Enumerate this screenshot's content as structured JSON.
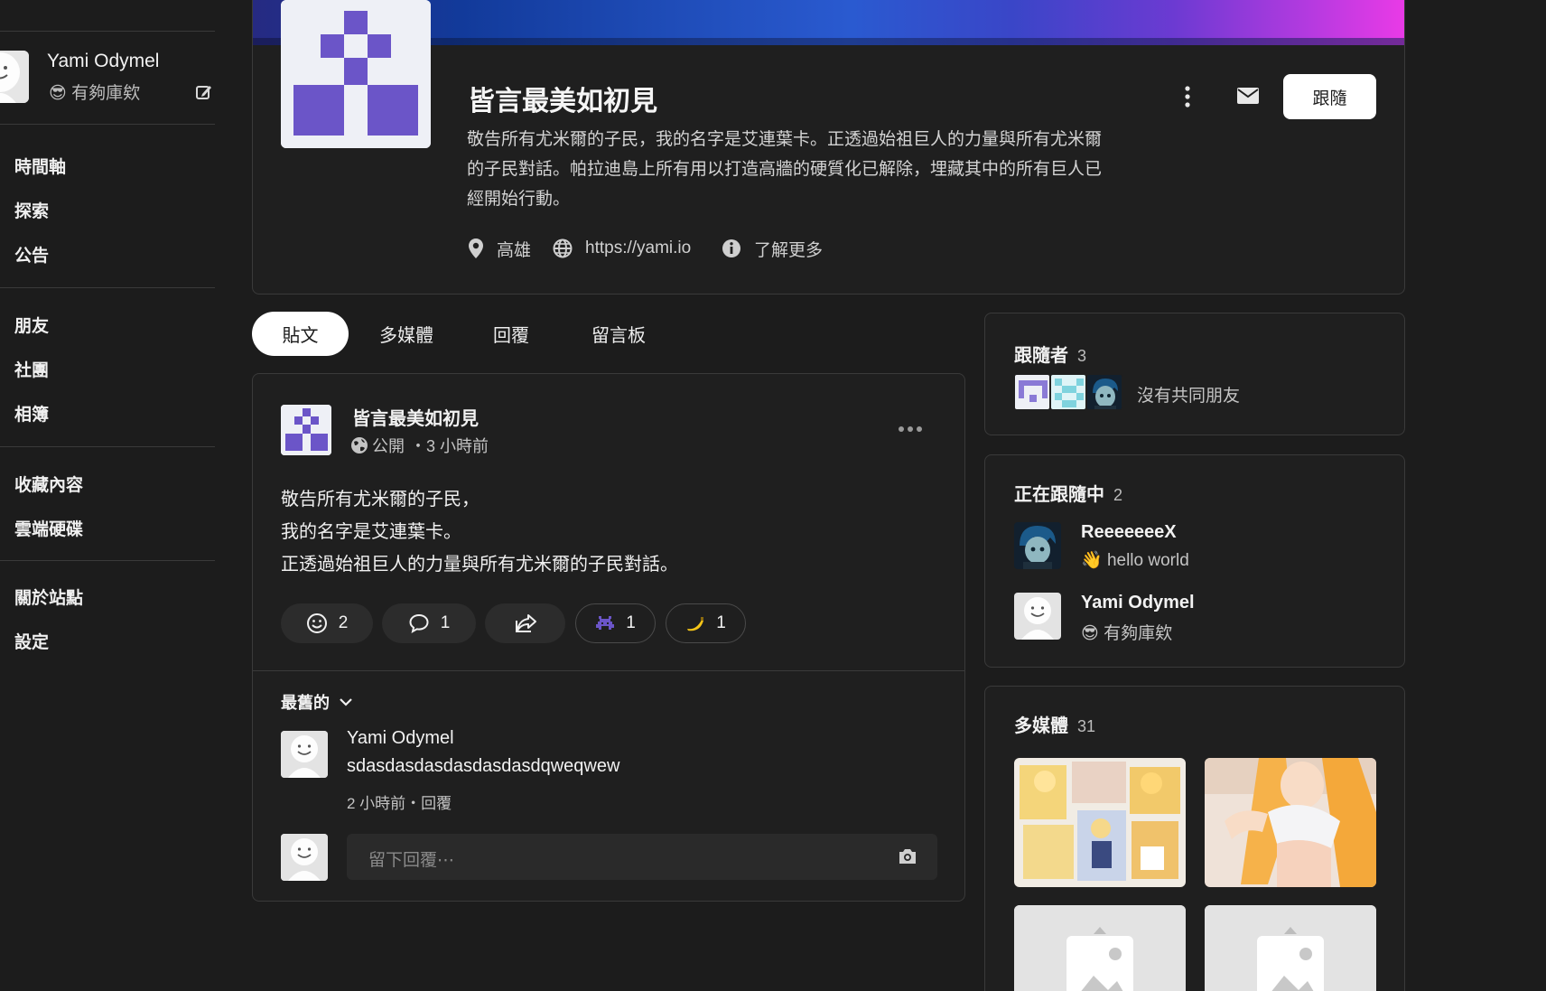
{
  "sidebar": {
    "user": {
      "name": "Yami Odymel",
      "status_emoji": "😎",
      "status": "有夠庫欸"
    },
    "nav": [
      {
        "label": "時間軸"
      },
      {
        "label": "探索"
      },
      {
        "label": "公告"
      },
      {
        "label": "朋友"
      },
      {
        "label": "社團"
      },
      {
        "label": "相簿"
      },
      {
        "label": "收藏內容"
      },
      {
        "label": "雲端硬碟"
      },
      {
        "label": "關於站點"
      },
      {
        "label": "設定"
      }
    ]
  },
  "profile": {
    "name": "皆言最美如初見",
    "bio": "敬告所有尤米爾的子民，我的名字是艾連葉卡。正透過始祖巨人的力量與所有尤米爾的子民對話。帕拉迪島上所有用以打造高牆的硬質化已解除，埋藏其中的所有巨人已經開始行動。",
    "location": "高雄",
    "website": "https://yami.io",
    "more": "了解更多",
    "follow_label": "跟隨"
  },
  "tabs": [
    {
      "label": "貼文",
      "active": true
    },
    {
      "label": "多媒體",
      "active": false
    },
    {
      "label": "回覆",
      "active": false
    },
    {
      "label": "留言板",
      "active": false
    }
  ],
  "post": {
    "author": "皆言最美如初見",
    "visibility": "公開",
    "time": "・3 小時前",
    "lines": [
      "敬告所有尤米爾的子民，",
      "我的名字是艾連葉卡。",
      "正透過始祖巨人的力量與所有尤米爾的子民對話。"
    ],
    "reactions": [
      {
        "icon": "smile-icon",
        "count": "2"
      },
      {
        "icon": "comment-icon",
        "count": "1"
      },
      {
        "icon": "share-icon",
        "count": ""
      },
      {
        "icon": "alien-monster-icon",
        "count": "1"
      },
      {
        "icon": "banana-icon",
        "count": "1"
      }
    ],
    "sort_label": "最舊的",
    "comment": {
      "author": "Yami Odymel",
      "text": "sdasdasdasdasdasdasdqweqwew",
      "meta": "2 小時前・回覆"
    },
    "reply_placeholder": "留下回覆⋯"
  },
  "followers": {
    "title": "跟隨者",
    "count": "3",
    "note": "沒有共同朋友"
  },
  "following": {
    "title": "正在跟隨中",
    "count": "2",
    "users": [
      {
        "name": "ReeeeeeeX",
        "status_emoji": "👋",
        "status": "hello world"
      },
      {
        "name": "Yami Odymel",
        "status_emoji": "😎",
        "status": "有夠庫欸"
      }
    ]
  },
  "media": {
    "title": "多媒體",
    "count": "31"
  },
  "colors": {
    "accent": "#6b55c8",
    "card_bg": "#1f1f1f",
    "page_bg": "#1c1c1c",
    "border": "#3a3a3a"
  }
}
